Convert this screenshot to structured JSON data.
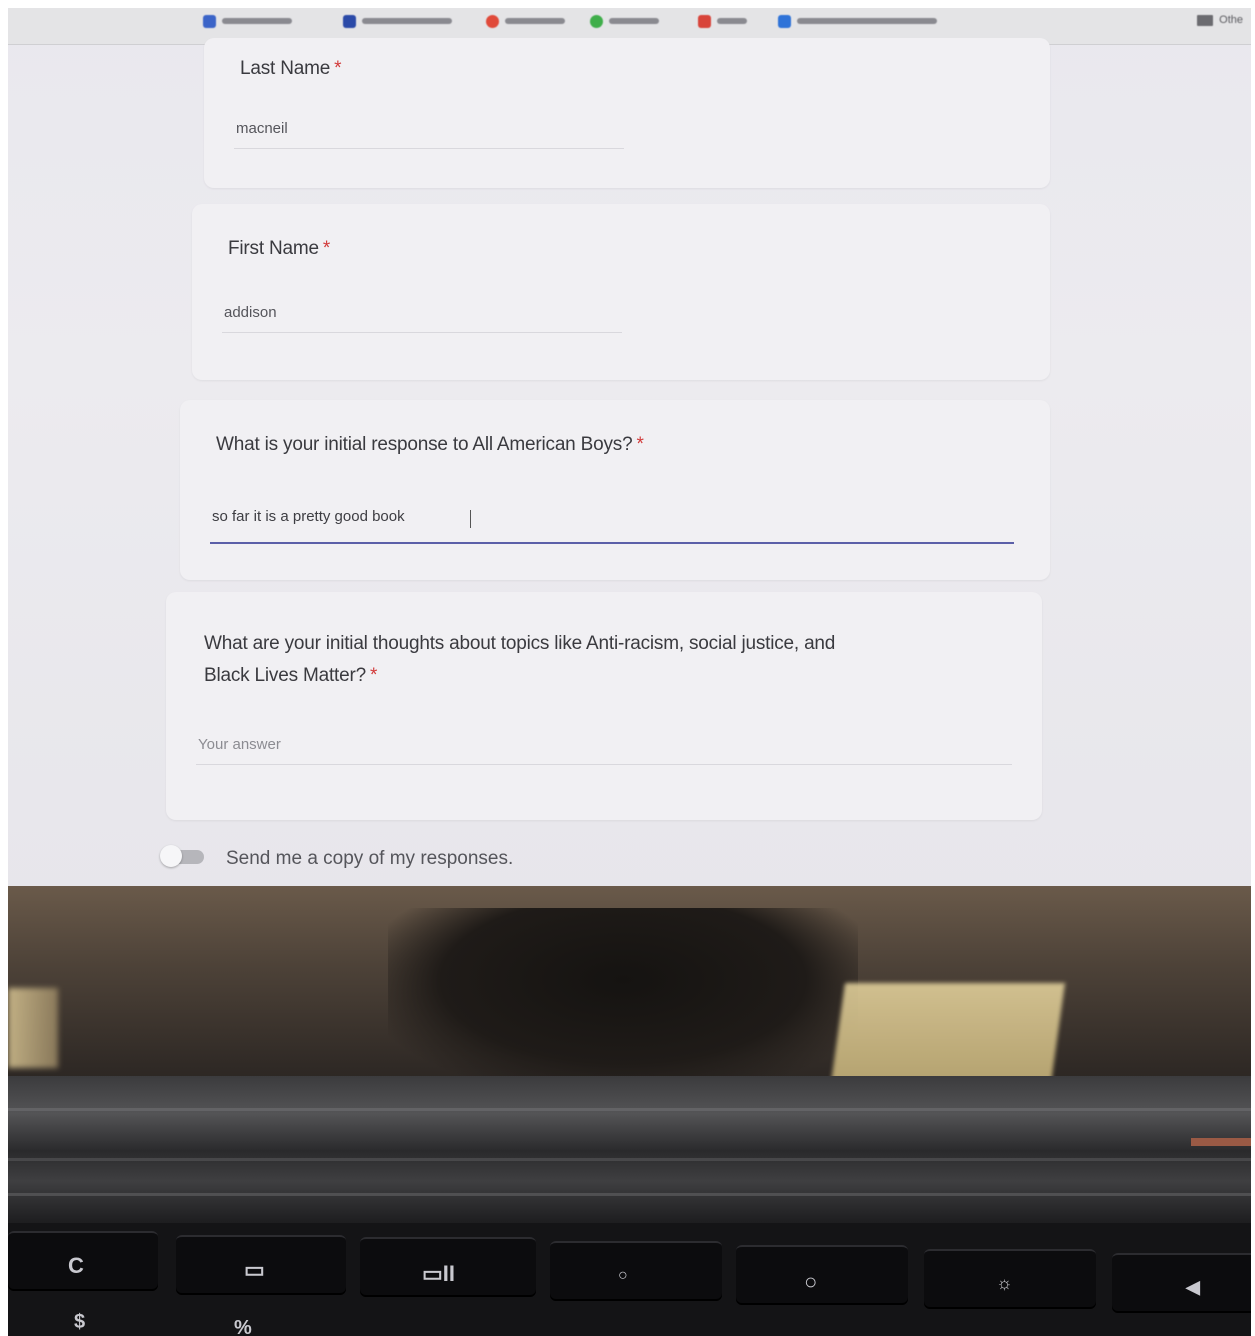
{
  "bookmarks": {
    "folder_label": "Othe"
  },
  "form": {
    "last_name": {
      "label": "Last Name",
      "required_mark": "*",
      "value": "macneil"
    },
    "first_name": {
      "label": "First Name",
      "required_mark": "*",
      "value": "addison"
    },
    "initial_response": {
      "label": "What is your initial response to All American Boys?",
      "required_mark": "*",
      "value": "so far it is a pretty good book"
    },
    "thoughts": {
      "label_line1": "What are your initial thoughts about topics like Anti-racism, social justice, and",
      "label_line2": "Black Lives Matter?",
      "required_mark": "*",
      "placeholder": "Your answer"
    },
    "send_copy": {
      "label": "Send me a copy of my responses.",
      "checked": false
    }
  },
  "keyboard": {
    "top_row_glyphs": [
      "C",
      "▭",
      "▭II",
      "○",
      "○",
      "☼",
      "◀"
    ],
    "bottom_row_glyphs": [
      "$",
      "%"
    ]
  },
  "colors": {
    "focus_underline": "#5b5fa8",
    "required": "#d23a3a"
  }
}
